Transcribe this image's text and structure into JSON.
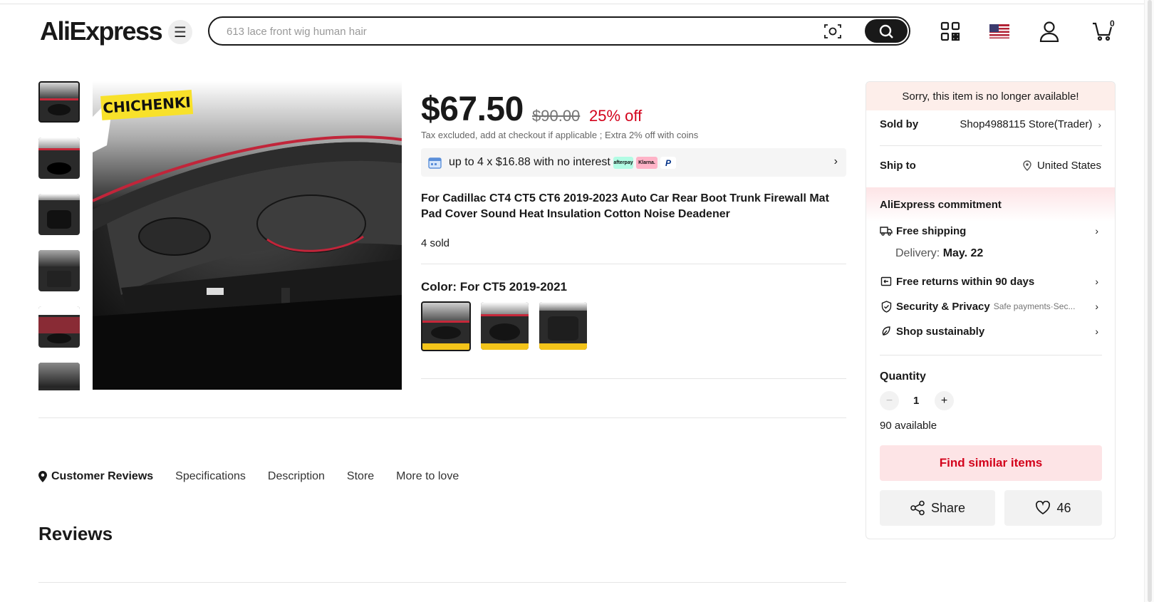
{
  "header": {
    "logo": "AliExpress",
    "search_placeholder": "613 lace front wig human hair",
    "cart_count": "0"
  },
  "gallery": {
    "brand_label": "CHICHENKI"
  },
  "product": {
    "price": "$67.50",
    "original_price": "$90.00",
    "discount": "25% off",
    "tax_note": "Tax excluded, add at checkout if applicable ; Extra 2% off with coins",
    "installment_text": "up to 4 x $16.88 with no interest",
    "payment_badges": [
      "afterpay",
      "Klarna.",
      "P"
    ],
    "title": "For Cadillac CT4 CT5 CT6 2019-2023 Auto Car Rear Boot Trunk Firewall Mat Pad Cover Sound Heat Insulation Cotton Noise Deadener",
    "sold": "4 sold",
    "color_label": "Color: For CT5 2019-2021"
  },
  "tabs": [
    "Customer Reviews",
    "Specifications",
    "Description",
    "Store",
    "More to love"
  ],
  "reviews_heading": "Reviews",
  "sidebar": {
    "unavailable_msg": "Sorry, this item is no longer available!",
    "sold_by_label": "Sold by",
    "store_name": "Shop4988115 Store(Trader)",
    "ship_to_label": "Ship to",
    "ship_to_value": "United States",
    "commitment_title": "AliExpress commitment",
    "free_shipping": "Free shipping",
    "delivery_label": "Delivery:",
    "delivery_date": "May. 22",
    "free_returns": "Free returns within 90 days",
    "security": "Security & Privacy",
    "security_sub": "Safe payments·Sec...",
    "sustainable": "Shop sustainably",
    "quantity_label": "Quantity",
    "quantity": "1",
    "available": "90 available",
    "find_similar": "Find similar items",
    "share": "Share",
    "wishlist_count": "46"
  },
  "colors": {
    "accent_red": "#d3031c",
    "pink_bg": "#fde4e6",
    "text": "#191919"
  }
}
